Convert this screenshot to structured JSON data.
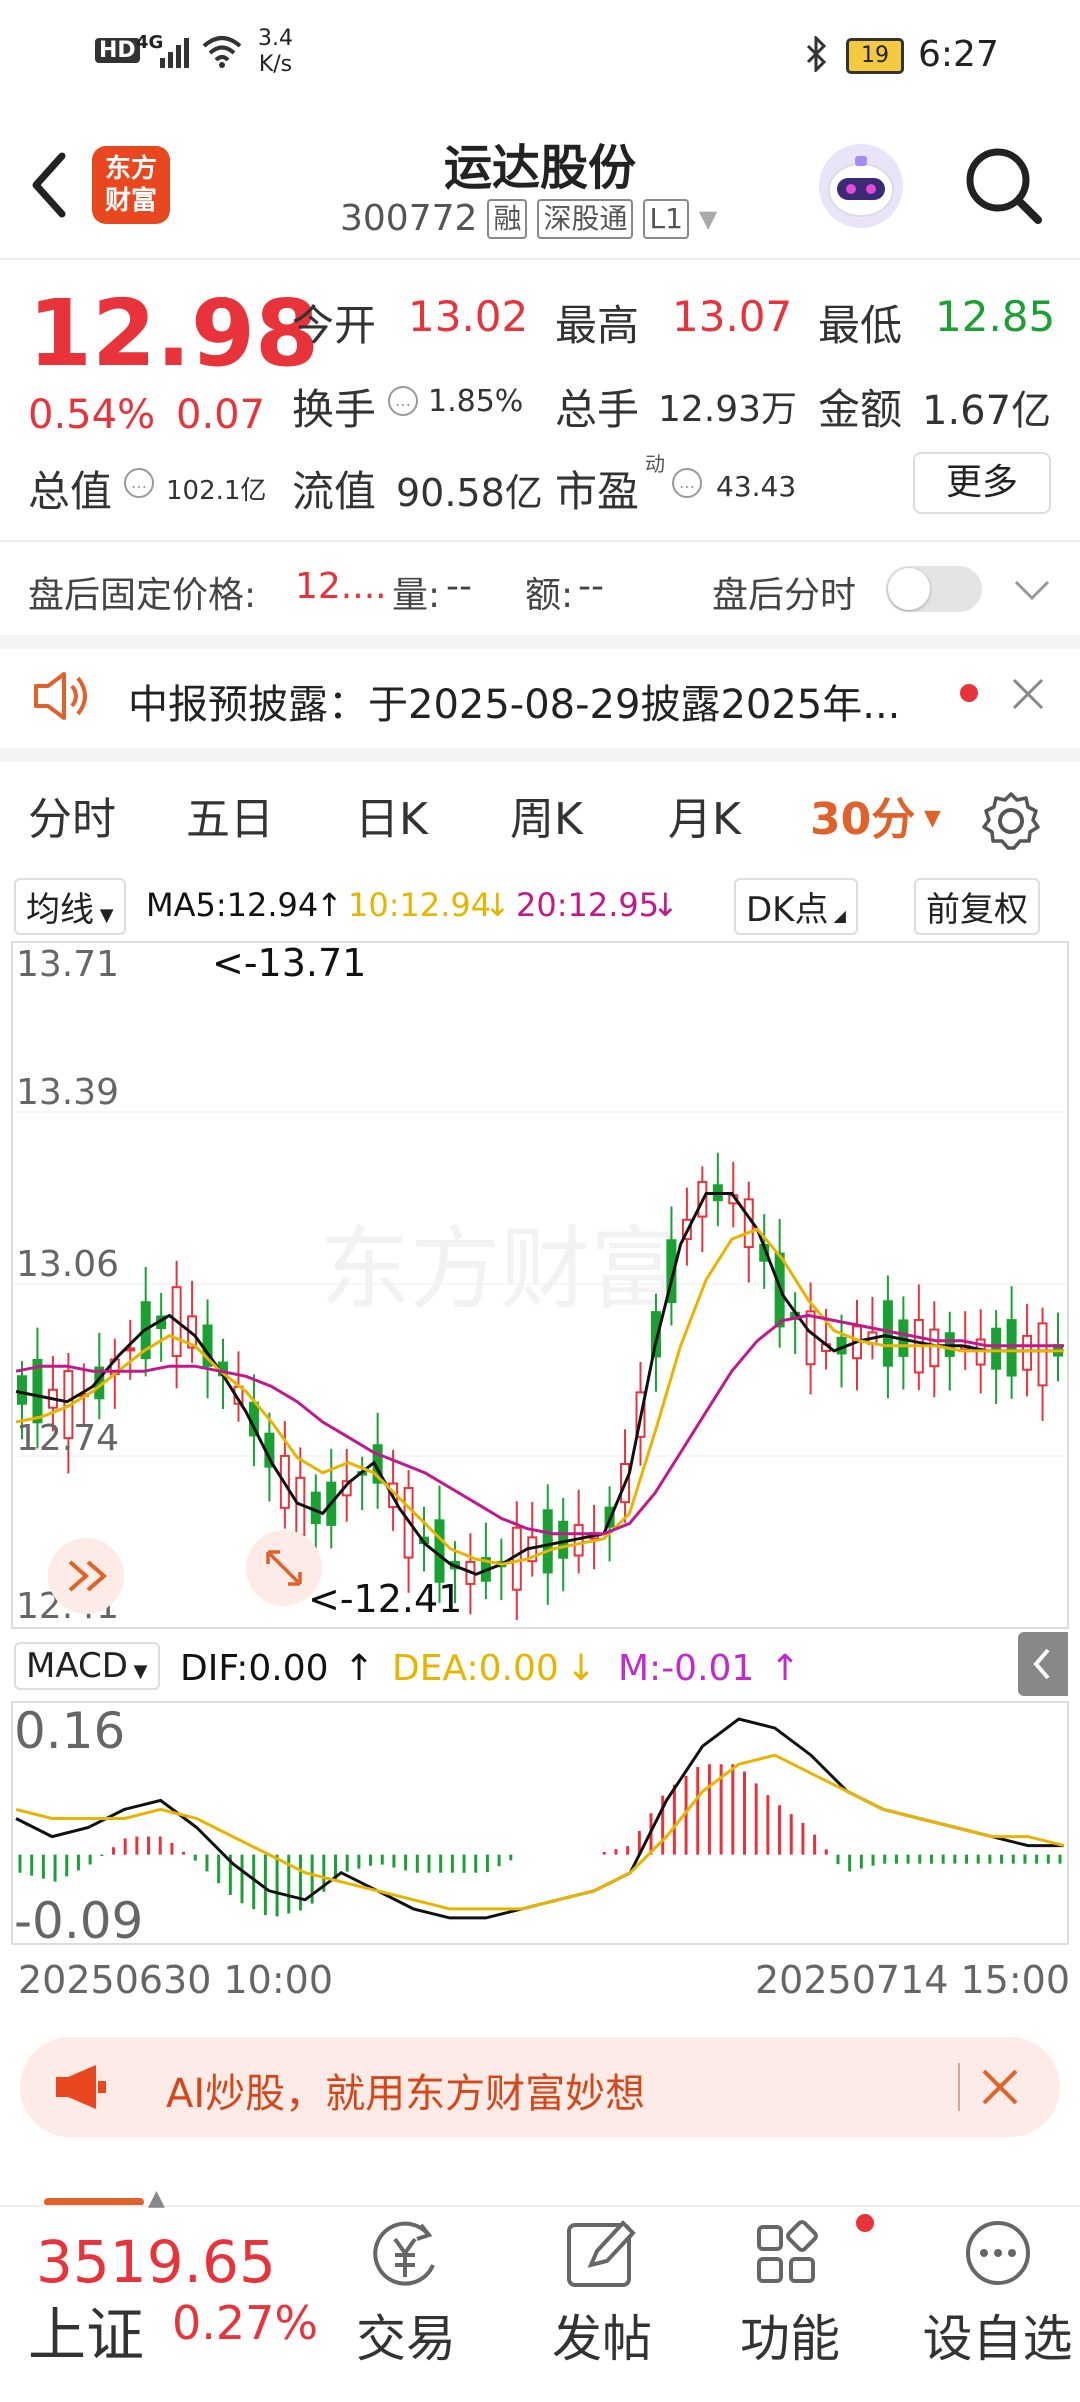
{
  "status_bar": {
    "network": "4G",
    "speed_value": "3.4",
    "speed_unit": "K/s",
    "battery": "19",
    "time": "6:27"
  },
  "header": {
    "app_logo": "东方\n财富",
    "stock_name": "运达股份",
    "stock_code": "300772",
    "tags": [
      "融",
      "深股通",
      "L1"
    ]
  },
  "quote": {
    "price": "12.98",
    "change_pct": "0.54%",
    "change_abs": "0.07",
    "open_label": "今开",
    "open_value": "13.02",
    "high_label": "最高",
    "high_value": "13.07",
    "low_label": "最低",
    "low_value": "12.85",
    "turnover_label": "换手",
    "turnover_value": "1.85%",
    "volume_label": "总手",
    "volume_value": "12.93万",
    "amount_label": "金额",
    "amount_value": "1.67亿",
    "market_cap_label": "总值",
    "market_cap_value": "102.1亿",
    "float_cap_label": "流值",
    "float_cap_value": "90.58亿",
    "pe_label": "市盈",
    "pe_sup": "动",
    "pe_value": "43.43",
    "more_label": "更多"
  },
  "after_hours": {
    "price_label": "盘后固定价格:",
    "price_value": "12....",
    "vol_label": "量:",
    "vol_value": "--",
    "amt_label": "额:",
    "amt_value": "--",
    "toggle_label": "盘后分时"
  },
  "notice": {
    "text": "中报预披露：于2025-08-29披露2025年..."
  },
  "chart_tabs": [
    "分时",
    "五日",
    "日K",
    "周K",
    "月K",
    "30分"
  ],
  "chart_toolbar": {
    "ma_selector": "均线",
    "ma5": "MA5:12.94",
    "ma10": "10:12.94",
    "ma20": "20:12.95",
    "dk_label": "DK点",
    "adjust_label": "前复权"
  },
  "macd_toolbar": {
    "selector": "MACD",
    "dif": "DIF:0.00",
    "dea": "DEA:0.00",
    "m": "M:-0.01"
  },
  "chart_axis": {
    "y_labels": [
      "13.71",
      "13.39",
      "13.06",
      "12.74",
      "12.41"
    ],
    "max_label": "<-13.71",
    "min_label": "<-12.41",
    "macd_top": "0.16",
    "macd_bottom": "-0.09",
    "start_time": "20250630 10:00",
    "end_time": "20250714 15:00",
    "watermark": "东方财富"
  },
  "chart_data": {
    "type": "candlestick",
    "title": "",
    "xlabel": "",
    "ylabel": "",
    "ylim": [
      12.41,
      13.71
    ],
    "x_range": [
      "20250630 10:00",
      "20250714 15:00"
    ],
    "series": [
      {
        "name": "MA5",
        "values": [
          12.86,
          12.85,
          12.84,
          12.87,
          12.93,
          12.98,
          13.01,
          12.97,
          12.9,
          12.82,
          12.72,
          12.64,
          12.62,
          12.68,
          12.72,
          12.63,
          12.56,
          12.52,
          12.5,
          12.52,
          12.55,
          12.56,
          12.57,
          12.58,
          12.7,
          12.95,
          13.15,
          13.25,
          13.25,
          13.18,
          13.05,
          12.98,
          12.94,
          12.96,
          12.97,
          12.96,
          12.95,
          12.95,
          12.94,
          12.94,
          12.94,
          12.94
        ]
      },
      {
        "name": "MA10",
        "values": [
          12.8,
          12.81,
          12.83,
          12.86,
          12.9,
          12.94,
          12.97,
          12.95,
          12.9,
          12.86,
          12.8,
          12.73,
          12.7,
          12.72,
          12.7,
          12.65,
          12.6,
          12.55,
          12.53,
          12.52,
          12.53,
          12.55,
          12.56,
          12.57,
          12.62,
          12.78,
          12.95,
          13.08,
          13.16,
          13.18,
          13.12,
          13.04,
          12.98,
          12.96,
          12.95,
          12.95,
          12.95,
          12.94,
          12.94,
          12.94,
          12.94,
          12.94
        ]
      },
      {
        "name": "MA20",
        "values": [
          12.9,
          12.91,
          12.91,
          12.9,
          12.9,
          12.9,
          12.91,
          12.91,
          12.9,
          12.89,
          12.87,
          12.84,
          12.8,
          12.77,
          12.74,
          12.72,
          12.7,
          12.67,
          12.64,
          12.61,
          12.59,
          12.58,
          12.58,
          12.58,
          12.6,
          12.66,
          12.74,
          12.82,
          12.9,
          12.96,
          13.0,
          13.01,
          13.0,
          12.99,
          12.98,
          12.97,
          12.96,
          12.96,
          12.95,
          12.95,
          12.95,
          12.95
        ]
      }
    ],
    "macd": {
      "ylim": [
        -0.09,
        0.16
      ],
      "dif": [
        0.04,
        0.02,
        0.03,
        0.05,
        0.06,
        0.03,
        -0.01,
        -0.04,
        -0.05,
        -0.02,
        -0.04,
        -0.06,
        -0.07,
        -0.07,
        -0.06,
        -0.05,
        -0.04,
        -0.02,
        0.06,
        0.12,
        0.15,
        0.14,
        0.11,
        0.07,
        0.05,
        0.04,
        0.03,
        0.02,
        0.01,
        0.01
      ],
      "dea": [
        0.05,
        0.04,
        0.04,
        0.04,
        0.05,
        0.04,
        0.02,
        0.0,
        -0.02,
        -0.03,
        -0.04,
        -0.05,
        -0.06,
        -0.06,
        -0.06,
        -0.05,
        -0.04,
        -0.02,
        0.02,
        0.07,
        0.1,
        0.11,
        0.09,
        0.07,
        0.05,
        0.04,
        0.03,
        0.02,
        0.02,
        0.01
      ],
      "m": [
        -0.02,
        -0.03,
        -0.01,
        0.02,
        0.02,
        -0.01,
        -0.05,
        -0.07,
        -0.06,
        -0.02,
        -0.01,
        -0.02,
        -0.02,
        -0.02,
        0.0,
        0.0,
        0.0,
        0.01,
        0.07,
        0.1,
        0.1,
        0.06,
        0.03,
        -0.02,
        -0.01,
        -0.01,
        -0.01,
        -0.01,
        -0.01,
        -0.01
      ]
    }
  },
  "ai_banner": {
    "text": "AI炒股，就用东方财富妙想"
  },
  "index_bar": {
    "value": "3519.65",
    "name": "上证",
    "change": "0.27%"
  },
  "bottom_nav": [
    "交易",
    "发帖",
    "功能",
    "设自选"
  ],
  "colors": {
    "up": "#e8333a",
    "down": "#1aa033",
    "accent": "#e0622a",
    "ma5": "#111111",
    "ma10": "#e8b400",
    "ma20": "#c2188b"
  }
}
